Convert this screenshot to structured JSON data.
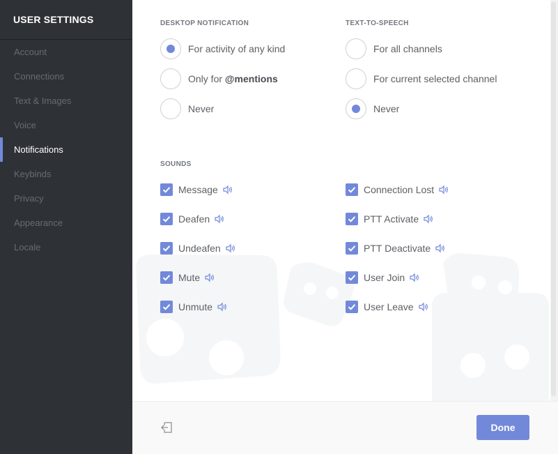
{
  "sidebar": {
    "title": "USER SETTINGS",
    "items": [
      {
        "label": "Account"
      },
      {
        "label": "Connections"
      },
      {
        "label": "Text & Images"
      },
      {
        "label": "Voice"
      },
      {
        "label": "Notifications"
      },
      {
        "label": "Keybinds"
      },
      {
        "label": "Privacy"
      },
      {
        "label": "Appearance"
      },
      {
        "label": "Locale"
      }
    ],
    "active_item": "Notifications"
  },
  "desktop_notification": {
    "heading": "DESKTOP NOTIFICATION",
    "options": [
      {
        "prefix": "For activity of any kind",
        "emphasis": "",
        "checked": true
      },
      {
        "prefix": "Only for ",
        "emphasis": "@mentions",
        "checked": false
      },
      {
        "prefix": "Never",
        "emphasis": "",
        "checked": false
      }
    ]
  },
  "text_to_speech": {
    "heading": "TEXT-TO-SPEECH",
    "options": [
      {
        "label": "For all channels",
        "checked": false
      },
      {
        "label": "For current selected channel",
        "checked": false
      },
      {
        "label": "Never",
        "checked": true
      }
    ]
  },
  "sounds": {
    "heading": "SOUNDS",
    "left": [
      {
        "label": "Message",
        "checked": true
      },
      {
        "label": "Deafen",
        "checked": true
      },
      {
        "label": "Undeafen",
        "checked": true
      },
      {
        "label": "Mute",
        "checked": true
      },
      {
        "label": "Unmute",
        "checked": true
      }
    ],
    "right": [
      {
        "label": "Connection Lost",
        "checked": true
      },
      {
        "label": "PTT Activate",
        "checked": true
      },
      {
        "label": "PTT Deactivate",
        "checked": true
      },
      {
        "label": "User Join",
        "checked": true
      },
      {
        "label": "User Leave",
        "checked": true
      }
    ]
  },
  "footer": {
    "done_label": "Done",
    "back_icon": "logout-icon"
  },
  "colors": {
    "accent": "#7289da",
    "sidebar_bg": "#2e3136"
  }
}
